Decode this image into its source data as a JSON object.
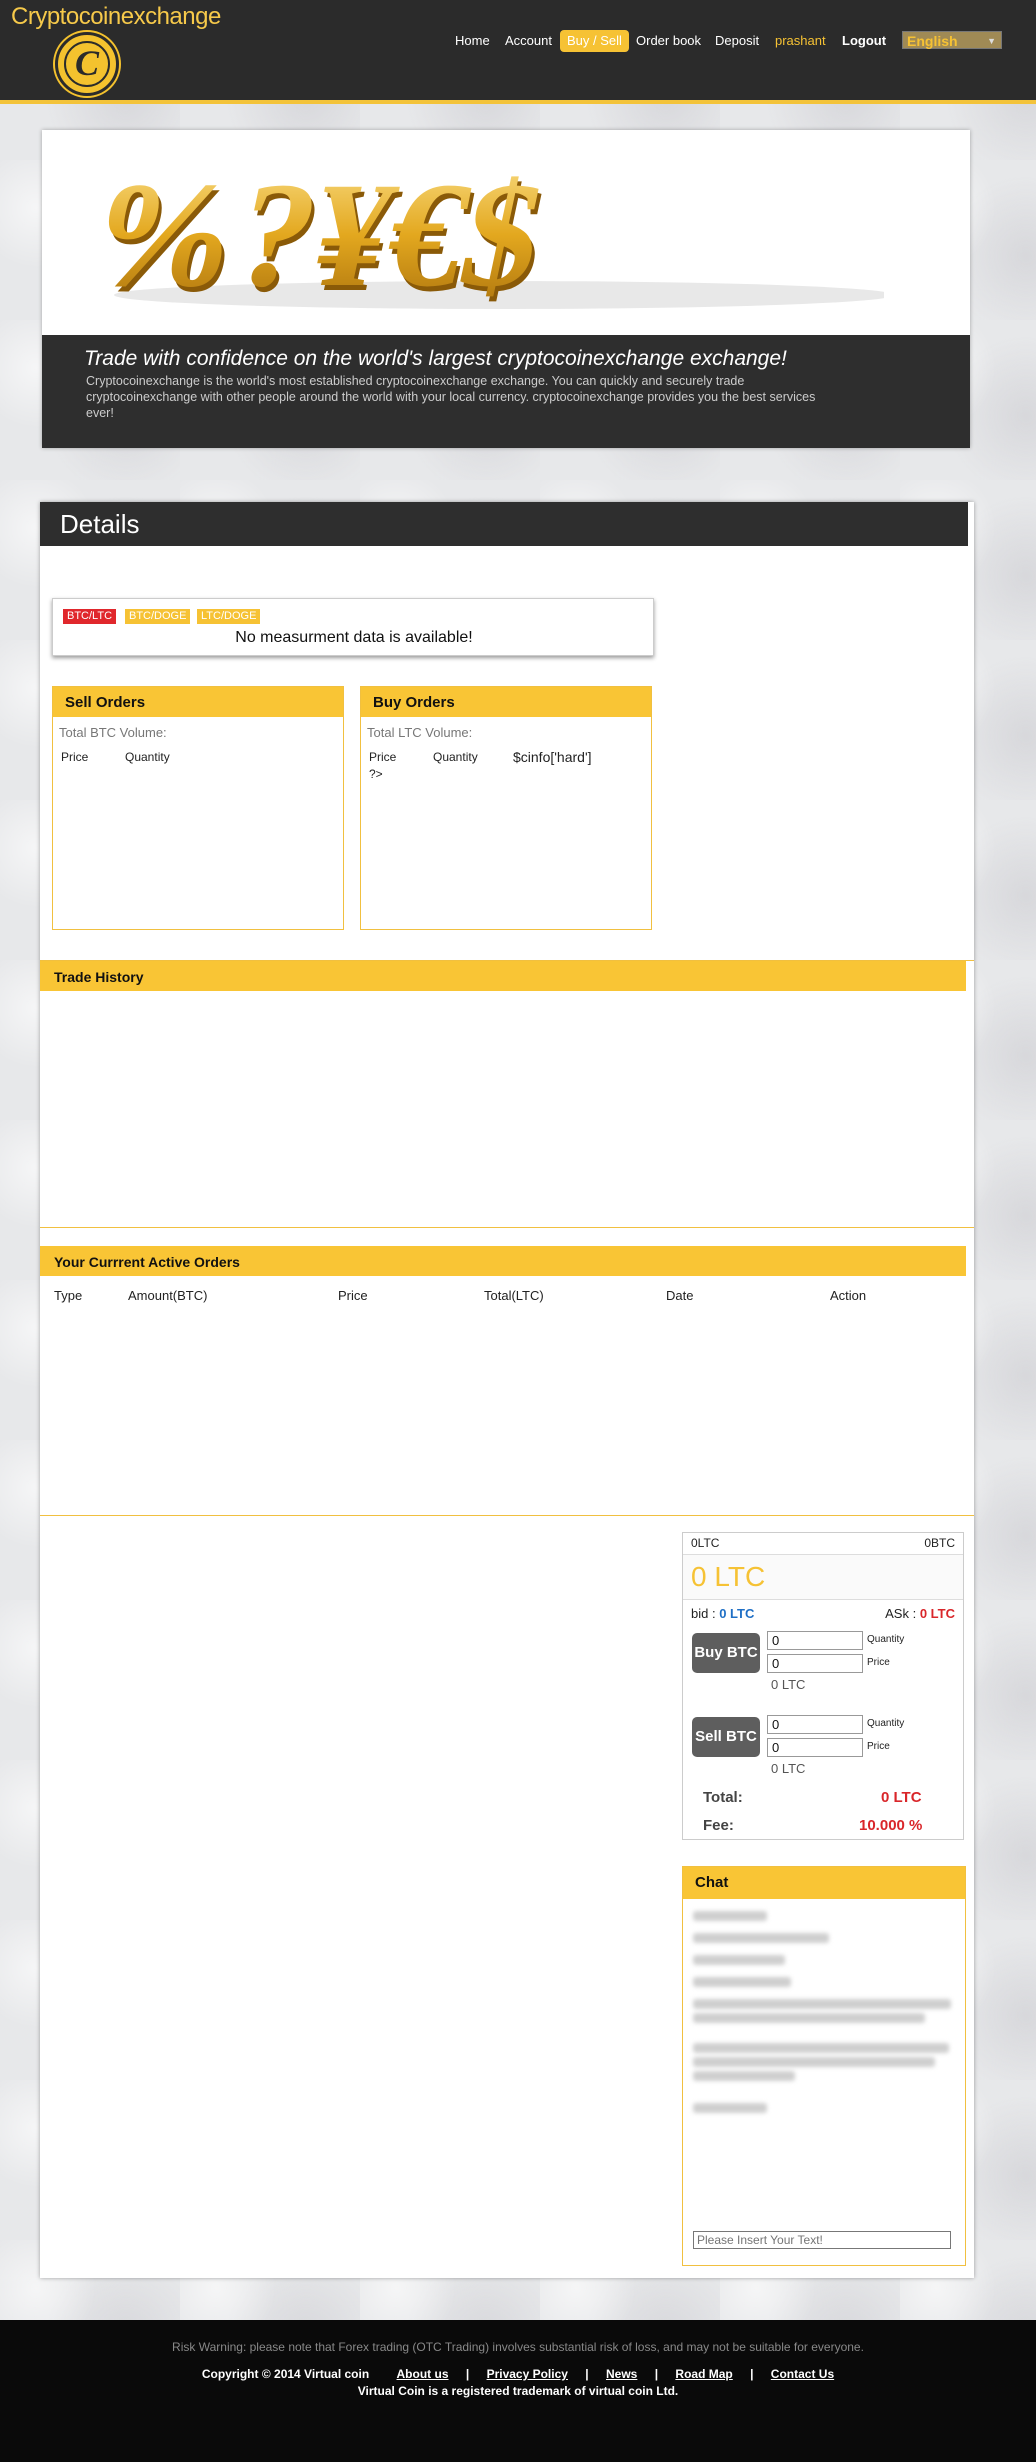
{
  "brand": {
    "name": "Cryptocoinexchange",
    "coin_letter": "C"
  },
  "nav": {
    "items": [
      {
        "label": "Home"
      },
      {
        "label": "Account"
      },
      {
        "label": "Buy / Sell",
        "active": true
      },
      {
        "label": "Order book"
      },
      {
        "label": "Deposit"
      },
      {
        "label": "prashant"
      },
      {
        "label": "Logout"
      }
    ],
    "language": "English"
  },
  "hero": {
    "symbols": "%?¥€$",
    "title": "Trade with confidence on the world's largest cryptocoinexchange exchange!",
    "text": "Cryptocoinexchange is the world's most established cryptocoinexchange exchange. You can quickly and securely trade cryptocoinexchange with other people around the world with your local currency. cryptocoinexchange provides you the best services ever!"
  },
  "details": {
    "title": "Details"
  },
  "chart": {
    "pairs": [
      "BTC/LTC",
      "BTC/DOGE",
      "LTC/DOGE"
    ],
    "message": "No measurment data is available!"
  },
  "sell_orders": {
    "title": "Sell Orders",
    "volume_label": "Total BTC Volume:",
    "columns": [
      "Price",
      "Quantity"
    ]
  },
  "buy_orders": {
    "title": "Buy Orders",
    "volume_label": "Total LTC Volume:",
    "columns": [
      "Price",
      "Quantity"
    ],
    "raw_code": "$cinfo['hard']",
    "raw_tail": "?>"
  },
  "trade_history": {
    "title": "Trade History"
  },
  "active_orders": {
    "title": "Your Currrent Active Orders",
    "columns": [
      "Type",
      "Amount(BTC)",
      "Price",
      "Total(LTC)",
      "Date",
      "Action"
    ]
  },
  "trade": {
    "ltc_balance": "0LTC",
    "btc_balance": "0BTC",
    "price_big": "0 LTC",
    "bid_label": "bid :",
    "bid_value": "0 LTC",
    "ask_label": "ASk :",
    "ask_value": "0 LTC",
    "buy": {
      "button": "Buy BTC",
      "quantity": "0",
      "price": "0",
      "quantity_label": "Quantity",
      "price_label": "Price",
      "total": "0 LTC"
    },
    "sell": {
      "button": "Sell BTC",
      "quantity": "0",
      "price": "0",
      "quantity_label": "Quantity",
      "price_label": "Price",
      "total": "0 LTC"
    },
    "total_label": "Total:",
    "total_value": "0 LTC",
    "fee_label": "Fee:",
    "fee_value": "10.000 %",
    "colors": {
      "accent": "#f6c234",
      "bid": "#1f6fc5",
      "ask": "#d9262a"
    }
  },
  "chat": {
    "title": "Chat",
    "placeholder": "Please Insert Your Text!"
  },
  "footer": {
    "risk": "Risk Warning: please note that Forex trading (OTC Trading) involves substantial risk of loss, and may not be suitable for everyone.",
    "copyright": "Copyright © 2014 Virtual coin",
    "links": [
      "About us",
      "Privacy Policy",
      "News",
      "Road Map",
      "Contact Us"
    ],
    "trademark": "Virtual Coin is a registered trademark of virtual coin Ltd."
  }
}
